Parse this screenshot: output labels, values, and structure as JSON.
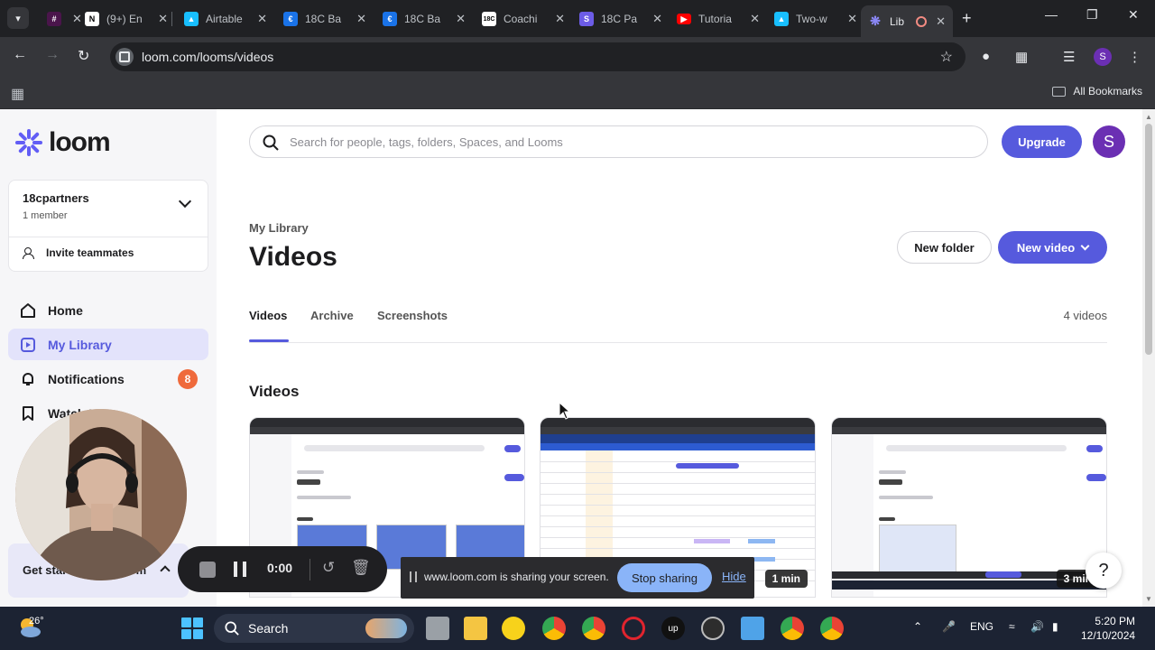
{
  "browser": {
    "tabs": [
      {
        "title": "",
        "icon": "slack-icon",
        "color": "#4a154b"
      },
      {
        "title": "(9+) En",
        "icon": "notion-icon",
        "color": "#ffffff"
      },
      {
        "title": "Airtable",
        "icon": "airtable-icon",
        "color": "#18bfff"
      },
      {
        "title": "18C Ba",
        "icon": "euro-icon",
        "color": "#1a73e8"
      },
      {
        "title": "18C Ba",
        "icon": "euro-icon",
        "color": "#1a73e8"
      },
      {
        "title": "Coachi",
        "icon": "18c-icon",
        "color": "#ffffff"
      },
      {
        "title": "18C Pa",
        "icon": "s-icon",
        "color": "#6c5ce7"
      },
      {
        "title": "Tutoria",
        "icon": "youtube-icon",
        "color": "#ff0000"
      },
      {
        "title": "Two-w",
        "icon": "airtable-icon",
        "color": "#18bfff"
      },
      {
        "title": "Lib",
        "icon": "loom-icon",
        "color": "#625df5",
        "active": true
      }
    ],
    "url": "loom.com/looms/videos",
    "all_bookmarks": "All Bookmarks",
    "profile_initial": "S"
  },
  "sidebar": {
    "logo_text": "loom",
    "workspace": {
      "name": "18cpartners",
      "members": "1 member",
      "invite_label": "Invite teammates"
    },
    "nav": [
      {
        "label": "Home",
        "icon": "home-icon"
      },
      {
        "label": "My Library",
        "icon": "library-icon",
        "active": true
      },
      {
        "label": "Notifications",
        "icon": "bell-icon",
        "badge": "8"
      },
      {
        "label": "Watch Later",
        "icon": "bookmark-icon"
      }
    ],
    "get_started": "Get started with Loom"
  },
  "header": {
    "search_placeholder": "Search for people, tags, folders, Spaces, and Looms",
    "upgrade_label": "Upgrade",
    "avatar_initial": "S"
  },
  "main": {
    "breadcrumb": "My Library",
    "title": "Videos",
    "new_folder_label": "New folder",
    "new_video_label": "New video",
    "tabs": [
      {
        "label": "Videos",
        "active": true
      },
      {
        "label": "Archive"
      },
      {
        "label": "Screenshots"
      }
    ],
    "video_count": "4 videos",
    "section_title": "Videos",
    "cards": [
      {
        "duration": ""
      },
      {
        "duration": "1 min"
      },
      {
        "duration": "3 min"
      }
    ]
  },
  "recorder": {
    "time": "0:00"
  },
  "share_banner": {
    "text": "www.loom.com is sharing your screen.",
    "stop_label": "Stop sharing",
    "hide_label": "Hide"
  },
  "help_label": "?",
  "taskbar": {
    "temperature": "26°",
    "search_label": "Search",
    "language": "ENG",
    "time": "5:20 PM",
    "date": "12/10/2024"
  }
}
